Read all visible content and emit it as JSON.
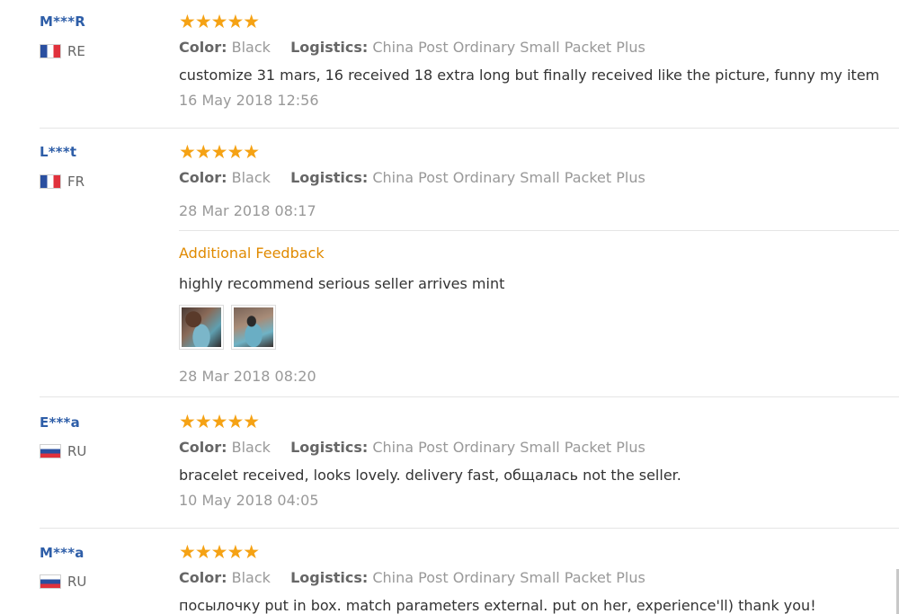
{
  "labels": {
    "color": "Color:",
    "logistics": "Logistics:",
    "additional_feedback": "Additional Feedback"
  },
  "stars_glyph": "★★★★★",
  "colors": {
    "user_name": "#2e5ea8",
    "star": "#f5a214",
    "additional_feedback_title": "#e08a00"
  },
  "reviews": [
    {
      "user": "M***R",
      "country": "RE",
      "flag": "france",
      "rating": 5,
      "color": "Black",
      "logistics": "China Post Ordinary Small Packet Plus",
      "text": "customize 31 mars, 16 received 18 extra long but finally received like the picture, funny my item",
      "date": "16 May 2018 12:56"
    },
    {
      "user": "L***t",
      "country": "FR",
      "flag": "france",
      "rating": 5,
      "color": "Black",
      "logistics": "China Post Ordinary Small Packet Plus",
      "date": "28 Mar 2018 08:17",
      "additional": {
        "text": "highly recommend serious seller arrives mint",
        "date": "28 Mar 2018 08:20"
      }
    },
    {
      "user": "E***a",
      "country": "RU",
      "flag": "russia",
      "rating": 5,
      "color": "Black",
      "logistics": "China Post Ordinary Small Packet Plus",
      "text": "bracelet received, looks lovely. delivery fast, общалась not the seller.",
      "date": "10 May 2018 04:05"
    },
    {
      "user": "M***a",
      "country": "RU",
      "flag": "russia",
      "rating": 5,
      "color": "Black",
      "logistics": "China Post Ordinary Small Packet Plus",
      "text": "посылочку put in box. match parameters external. put on her, experience'll) thank you!"
    }
  ]
}
